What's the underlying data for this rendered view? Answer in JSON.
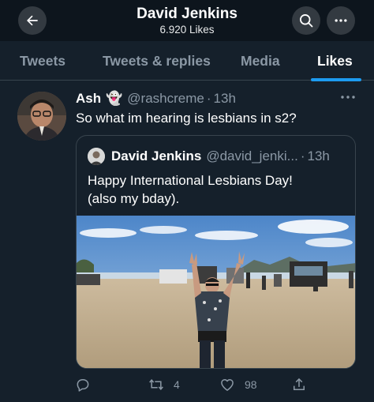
{
  "header": {
    "title": "David Jenkins",
    "subtitle": "6.920 Likes",
    "back_icon": "arrow-left-icon",
    "search_icon": "search-icon",
    "more_icon": "more-horizontal-icon"
  },
  "tabs": [
    {
      "label": "Tweets",
      "active": false
    },
    {
      "label": "Tweets & replies",
      "active": false
    },
    {
      "label": "Media",
      "active": false
    },
    {
      "label": "Likes",
      "active": true
    }
  ],
  "tweet": {
    "name": "Ash",
    "emoji": "👻",
    "handle": "@rashcreme",
    "dot": "·",
    "time": "13h",
    "text": "So what im hearing is lesbians in s2?",
    "quote": {
      "name": "David Jenkins",
      "handle": "@david_jenki...",
      "dot": "·",
      "time": "13h",
      "text_line1": "Happy International Lesbians Day!",
      "text_line2": "(also my bday)."
    },
    "actions": {
      "reply_icon": "reply-icon",
      "retweet_icon": "retweet-icon",
      "retweet_count": "4",
      "like_icon": "heart-icon",
      "like_count": "98",
      "share_icon": "share-icon"
    }
  },
  "colors": {
    "background": "#15202b",
    "header_background": "#0d151d",
    "accent": "#1d9bf0",
    "secondary_text": "#8b98a5",
    "border": "#38444d"
  }
}
